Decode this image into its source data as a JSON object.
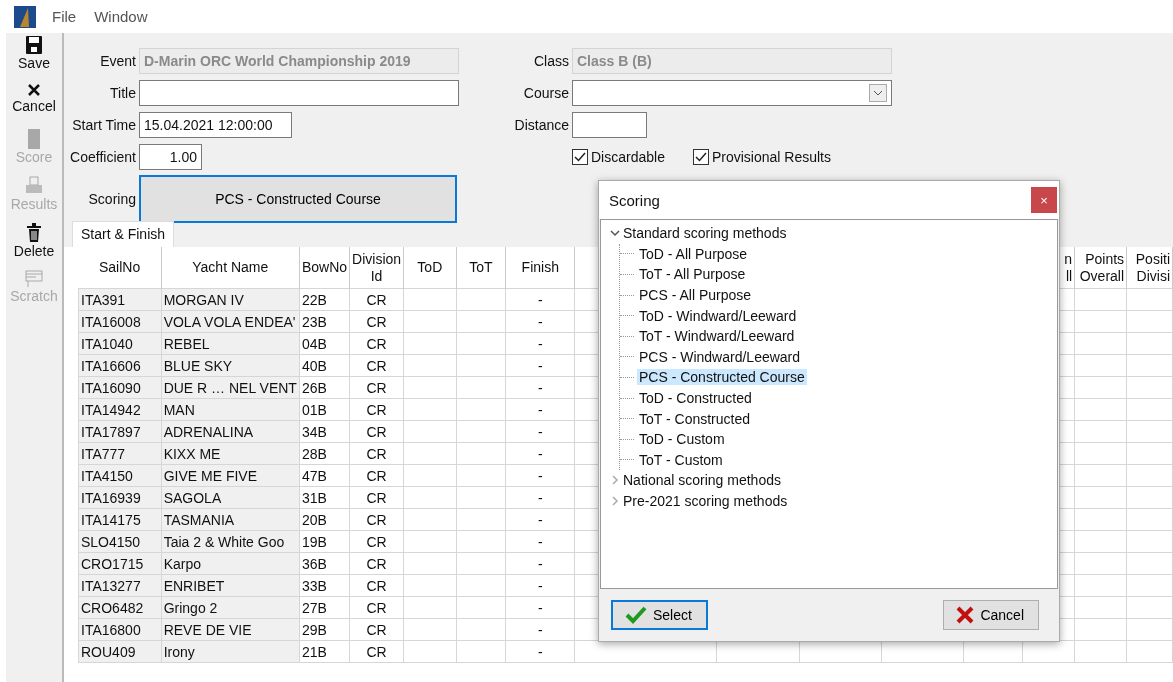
{
  "menu": [
    "File",
    "Window"
  ],
  "toolbar": [
    {
      "label": "Save",
      "kind": "save",
      "disabled": false
    },
    {
      "label": "Cancel",
      "kind": "cancel",
      "disabled": false
    },
    {
      "label": "Score",
      "kind": "score",
      "disabled": true
    },
    {
      "label": "Results",
      "kind": "results",
      "disabled": true
    },
    {
      "label": "Delete",
      "kind": "delete",
      "disabled": false
    },
    {
      "label": "Scratch",
      "kind": "scratch",
      "disabled": true
    }
  ],
  "form": {
    "event": {
      "label": "Event",
      "value": "D-Marin ORC World Championship 2019"
    },
    "title": {
      "label": "Title"
    },
    "start_time": {
      "label": "Start Time",
      "value": "15.04.2021 12:00:00"
    },
    "coefficient": {
      "label": "Coefficient",
      "value": "1.00"
    },
    "scoring": {
      "label": "Scoring",
      "value": "PCS - Constructed Course"
    },
    "class": {
      "label": "Class",
      "value": "Class B (B)"
    },
    "course": {
      "label": "Course"
    },
    "distance": {
      "label": "Distance"
    },
    "checkboxes": [
      {
        "label": "Discardable",
        "checked": true
      },
      {
        "label": "Provisional Results",
        "checked": true
      }
    ]
  },
  "tabs": [
    {
      "label": "Start & Finish",
      "selected": true
    }
  ],
  "table": {
    "columns": [
      "SailNo",
      "Yacht Name",
      "BowNo",
      "Division Id",
      "ToD",
      "ToT",
      "Finish"
    ],
    "right_columns": [
      "n ll",
      "Points Overall",
      "Positi Divisi"
    ],
    "rows": [
      [
        "ITA391",
        "MORGAN IV",
        "22B",
        "CR",
        "-"
      ],
      [
        "ITA16008",
        "VOLA VOLA ENDEA'",
        "23B",
        "CR",
        "-"
      ],
      [
        "ITA1040",
        "REBEL",
        "04B",
        "CR",
        "-"
      ],
      [
        "ITA16606",
        "BLUE SKY",
        "40B",
        "CR",
        "-"
      ],
      [
        "ITA16090",
        "DUE R … NEL VENT",
        "26B",
        "CR",
        "-"
      ],
      [
        "ITA14942",
        "MAN",
        "01B",
        "CR",
        "-"
      ],
      [
        "ITA17897",
        "ADRENALINA",
        "34B",
        "CR",
        "-"
      ],
      [
        "ITA777",
        "KIXX ME",
        "28B",
        "CR",
        "-"
      ],
      [
        "ITA4150",
        "GIVE ME FIVE",
        "47B",
        "CR",
        "-"
      ],
      [
        "ITA16939",
        "SAGOLA",
        "31B",
        "CR",
        "-"
      ],
      [
        "ITA14175",
        "TASMANIA",
        "20B",
        "CR",
        "-"
      ],
      [
        "SLO4150",
        "Taia 2 & White Goo",
        "19B",
        "CR",
        "-"
      ],
      [
        "CRO1715",
        "Karpo",
        "36B",
        "CR",
        "-"
      ],
      [
        "ITA13277",
        "ENRIBET",
        "33B",
        "CR",
        "-"
      ],
      [
        "CRO6482",
        "Gringo 2",
        "27B",
        "CR",
        "-"
      ],
      [
        "ITA16800",
        "REVE DE VIE",
        "29B",
        "CR",
        "-"
      ],
      [
        "ROU409",
        "Irony",
        "21B",
        "CR",
        "-"
      ]
    ]
  },
  "dialog": {
    "title": "Scoring",
    "close": "×",
    "tree": [
      {
        "label": "Standard scoring methods",
        "expanded": true,
        "children": [
          {
            "label": "ToD - All Purpose",
            "selected": false
          },
          {
            "label": "ToT - All Purpose",
            "selected": false
          },
          {
            "label": "PCS - All Purpose",
            "selected": false
          },
          {
            "label": "ToD - Windward/Leeward",
            "selected": false
          },
          {
            "label": "ToT - Windward/Leeward",
            "selected": false
          },
          {
            "label": "PCS - Windward/Leeward",
            "selected": false
          },
          {
            "label": "PCS - Constructed Course",
            "selected": true
          },
          {
            "label": "ToD - Constructed",
            "selected": false
          },
          {
            "label": "ToT - Constructed",
            "selected": false
          },
          {
            "label": "ToD - Custom",
            "selected": false
          },
          {
            "label": "ToT - Custom",
            "selected": false
          }
        ]
      },
      {
        "label": "National scoring methods",
        "expanded": false
      },
      {
        "label": "Pre-2021 scoring methods",
        "expanded": false
      }
    ],
    "buttons": [
      {
        "label": "Select",
        "kind": "select"
      },
      {
        "label": "Cancel",
        "kind": "cancel"
      }
    ]
  }
}
